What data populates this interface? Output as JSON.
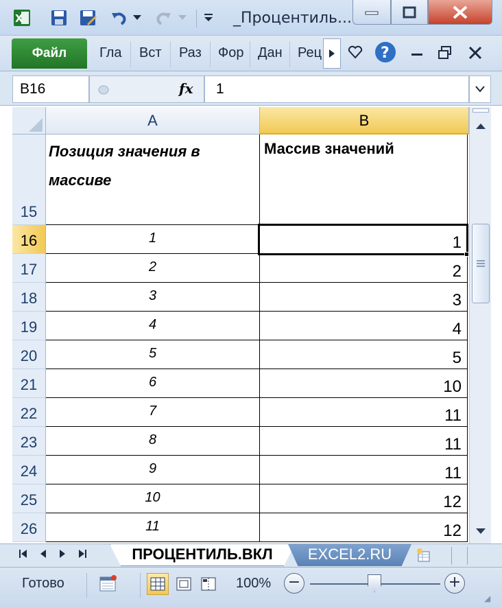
{
  "window": {
    "title": "_Процентиль...",
    "accent_green": "#217627",
    "close_color": "#c7422b"
  },
  "ribbon": {
    "file_label": "Файл",
    "tabs": [
      "Гла",
      "Вст",
      "Раз",
      "Фор",
      "Дан",
      "Рец"
    ]
  },
  "formula_bar": {
    "name_box": "B16",
    "fx_label": "fx",
    "value": "1"
  },
  "grid": {
    "column_headers": [
      "A",
      "B"
    ],
    "header_row": {
      "number": "15",
      "a": "Позиция значения в массиве",
      "b": "Массив значений"
    },
    "rows": [
      {
        "number": "16",
        "a": "1",
        "b": "1"
      },
      {
        "number": "17",
        "a": "2",
        "b": "2"
      },
      {
        "number": "18",
        "a": "3",
        "b": "3"
      },
      {
        "number": "19",
        "a": "4",
        "b": "4"
      },
      {
        "number": "20",
        "a": "5",
        "b": "5"
      },
      {
        "number": "21",
        "a": "6",
        "b": "10"
      },
      {
        "number": "22",
        "a": "7",
        "b": "11"
      },
      {
        "number": "23",
        "a": "8",
        "b": "11"
      },
      {
        "number": "24",
        "a": "9",
        "b": "11"
      },
      {
        "number": "25",
        "a": "10",
        "b": "12"
      },
      {
        "number": "26",
        "a": "11",
        "b": "12"
      }
    ],
    "selected_cell": "B16",
    "selection_color": "#f1c955"
  },
  "sheets": {
    "active": "ПРОЦЕНТИЛЬ.ВКЛ",
    "other": "EXCEL2.RU"
  },
  "status": {
    "text": "Готово",
    "zoom": "100%",
    "zoom_minus": "−",
    "zoom_plus": "+"
  }
}
